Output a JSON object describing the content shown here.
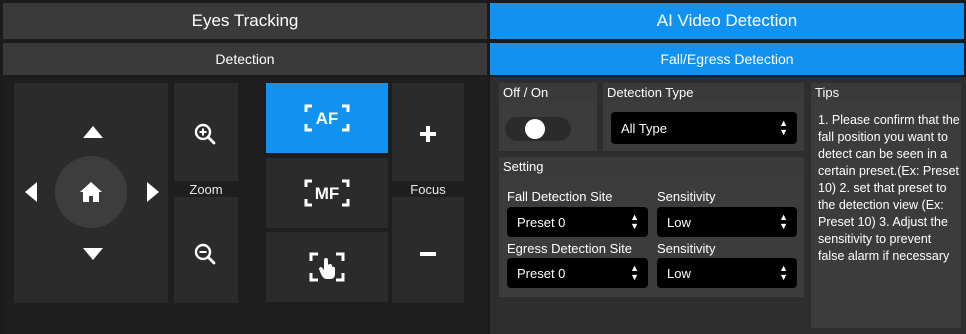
{
  "tabs": {
    "eyes_tracking": "Eyes Tracking",
    "ai_video_detection": "AI Video Detection"
  },
  "subtabs": {
    "detection": "Detection",
    "fall_egress": "Fall/Egress Detection"
  },
  "camera": {
    "zoom_label": "Zoom",
    "focus_label": "Focus",
    "af_label": "AF",
    "mf_label": "MF"
  },
  "settings": {
    "offon_label": "Off / On",
    "detection_type_label": "Detection Type",
    "detection_type_value": "All Type",
    "setting_label": "Setting",
    "fall_site_label": "Fall Detection Site",
    "fall_site_value": "Preset 0",
    "fall_sensitivity_label": "Sensitivity",
    "fall_sensitivity_value": "Low",
    "egress_site_label": "Egress Detection Site",
    "egress_site_value": "Preset 0",
    "egress_sensitivity_label": "Sensitivity",
    "egress_sensitivity_value": "Low",
    "toggle_on": false
  },
  "tips": {
    "title": "Tips",
    "text": "1. Please confirm that the fall position you want to detect can be seen in a certain preset.(Ex: Preset 10) 2. set that preset to the detection view (Ex: Preset 10) 3. Adjust the sensitivity to prevent false alarm if necessary"
  },
  "colors": {
    "accent": "#1192f0",
    "tab_inactive": "#3a3a3a",
    "panel": "#2b2b2b"
  },
  "icons": [
    "arrow-up-icon",
    "arrow-down-icon",
    "arrow-left-icon",
    "arrow-right-icon",
    "home-icon",
    "zoom-in-icon",
    "zoom-out-icon",
    "af-icon",
    "mf-icon",
    "touch-focus-icon",
    "plus-icon",
    "minus-icon",
    "chevron-updown-icon"
  ]
}
